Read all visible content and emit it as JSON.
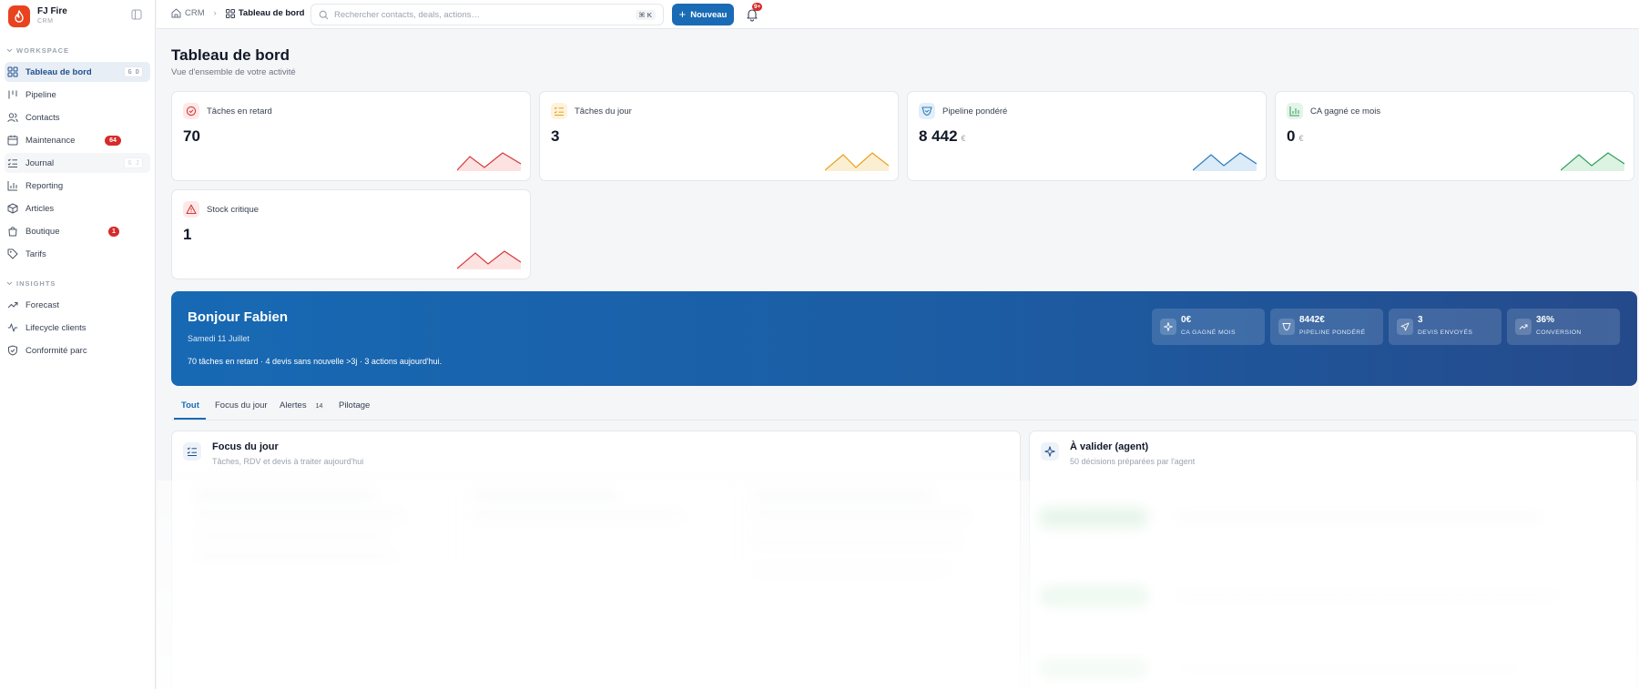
{
  "brand": {
    "name": "FJ Fire",
    "sub": "CRM"
  },
  "sidebar": {
    "workspace_label": "WORKSPACE",
    "insights_label": "INSIGHTS",
    "workspace_items": [
      {
        "label": "Tableau de bord",
        "shortcut": "G D"
      },
      {
        "label": "Pipeline"
      },
      {
        "label": "Contacts"
      },
      {
        "label": "Maintenance",
        "badge": "64"
      },
      {
        "label": "Journal",
        "shortcut": "G J"
      },
      {
        "label": "Reporting"
      },
      {
        "label": "Articles"
      },
      {
        "label": "Boutique",
        "badge": "1"
      },
      {
        "label": "Tarifs"
      }
    ],
    "insights_items": [
      {
        "label": "Forecast"
      },
      {
        "label": "Lifecycle clients"
      },
      {
        "label": "Conformité parc"
      }
    ]
  },
  "topbar": {
    "crumb_root": "CRM",
    "crumb_current": "Tableau de bord",
    "search_placeholder": "Rechercher contacts, deals, actions…",
    "search_shortcut": "⌘ K",
    "new_button": "Nouveau",
    "notif_badge": "9+"
  },
  "page": {
    "title": "Tableau de bord",
    "subtitle": "Vue d'ensemble de votre activité"
  },
  "kpis": [
    {
      "label": "Tâches en retard",
      "value": "70",
      "unit": "",
      "color": "#d63a3a",
      "bg": "#fde8e8"
    },
    {
      "label": "Tâches du jour",
      "value": "3",
      "unit": "",
      "color": "#e7a21c",
      "bg": "#fdf3dd"
    },
    {
      "label": "Pipeline pondéré",
      "value": "8 442",
      "unit": "€",
      "color": "#2a7ab8",
      "bg": "#e2eefa"
    },
    {
      "label": "CA gagné ce mois",
      "value": "0",
      "unit": "€",
      "color": "#2f9e56",
      "bg": "#e3f4e9"
    },
    {
      "label": "Stock critique",
      "value": "1",
      "unit": "",
      "color": "#d63a3a",
      "bg": "#fde8e8"
    }
  ],
  "hero": {
    "greeting": "Bonjour Fabien",
    "date": "Samedi 11 Juillet",
    "summary": "70 tâches en retard · 4 devis sans nouvelle >3j · 3 actions aujourd'hui.",
    "stats": [
      {
        "value": "0€",
        "label": "CA GAGNÉ MOIS"
      },
      {
        "value": "8442€",
        "label": "PIPELINE PONDÉRÉ"
      },
      {
        "value": "3",
        "label": "DEVIS ENVOYÉS"
      },
      {
        "value": "36%",
        "label": "CONVERSION"
      }
    ]
  },
  "tabs": {
    "all": "Tout",
    "focus": "Focus du jour",
    "alerts": "Alertes",
    "alerts_count": "14",
    "pilotage": "Pilotage"
  },
  "focus_card": {
    "title": "Focus du jour",
    "subtitle": "Tâches, RDV et devis à traiter aujourd'hui"
  },
  "agent_card": {
    "title": "À valider (agent)",
    "subtitle": "50 décisions préparées par l'agent"
  }
}
